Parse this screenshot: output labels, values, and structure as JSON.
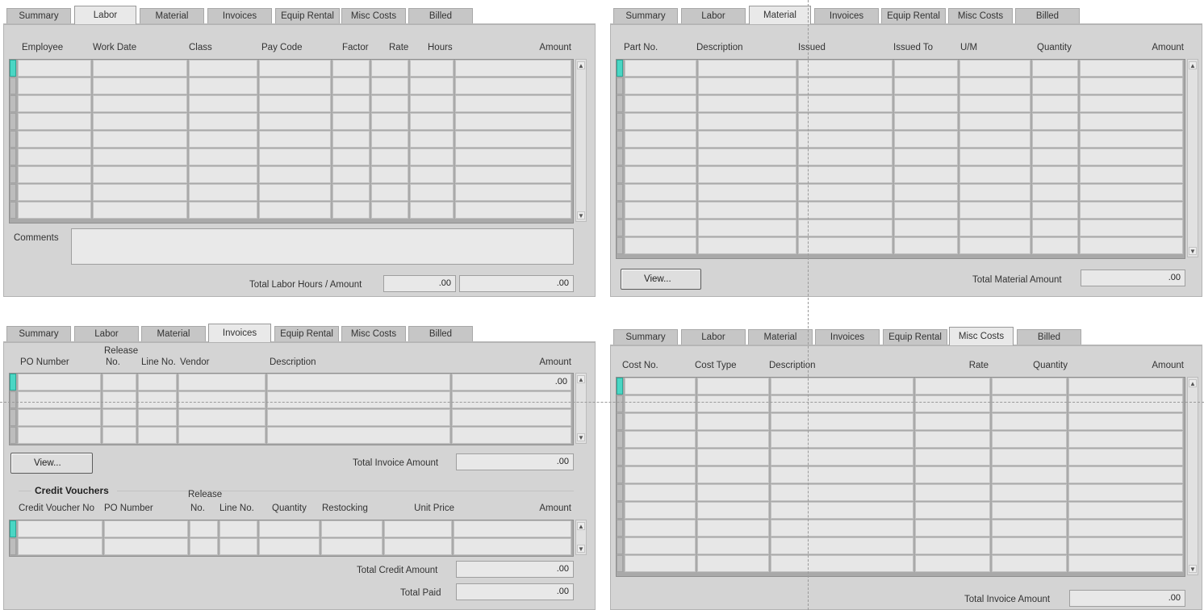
{
  "tabs": [
    "Summary",
    "Labor",
    "Material",
    "Invoices",
    "Equip Rental",
    "Misc Costs",
    "Billed"
  ],
  "labor": {
    "headers": {
      "employee": "Employee",
      "work_date": "Work Date",
      "class": "Class",
      "pay_code": "Pay Code",
      "factor": "Factor",
      "rate": "Rate",
      "hours": "Hours",
      "amount": "Amount"
    },
    "comments_label": "Comments",
    "total_label": "Total Labor  Hours / Amount",
    "total_hours": ".00",
    "total_amount": ".00"
  },
  "material": {
    "headers": {
      "part_no": "Part No.",
      "description": "Description",
      "issued": "Issued",
      "issued_to": "Issued To",
      "um": "U/M",
      "quantity": "Quantity",
      "amount": "Amount"
    },
    "view_button": "View...",
    "total_label": "Total Material Amount",
    "total_amount": ".00"
  },
  "invoices": {
    "headers": {
      "po_number": "PO Number",
      "release_l1": "Release",
      "release_l2": "No.",
      "line_no": "Line No.",
      "vendor": "Vendor",
      "description": "Description",
      "amount": "Amount"
    },
    "first_row_amount": ".00",
    "view_button": "View...",
    "total_invoice_label": "Total Invoice Amount",
    "total_invoice_amount": ".00",
    "credit": {
      "title": "Credit Vouchers",
      "headers": {
        "credit_voucher_no": "Credit Voucher No",
        "po_number": "PO Number",
        "release_l1": "Release",
        "release_l2": "No.",
        "line_no": "Line No.",
        "quantity": "Quantity",
        "restocking": "Restocking",
        "unit_price": "Unit Price",
        "amount": "Amount"
      },
      "total_credit_label": "Total Credit Amount",
      "total_credit_amount": ".00",
      "total_paid_label": "Total Paid",
      "total_paid_amount": ".00"
    }
  },
  "misc": {
    "headers": {
      "cost_no": "Cost No.",
      "cost_type": "Cost Type",
      "description": "Description",
      "rate": "Rate",
      "quantity": "Quantity",
      "amount": "Amount"
    },
    "total_label": "Total Invoice Amount",
    "total_amount": ".00"
  }
}
